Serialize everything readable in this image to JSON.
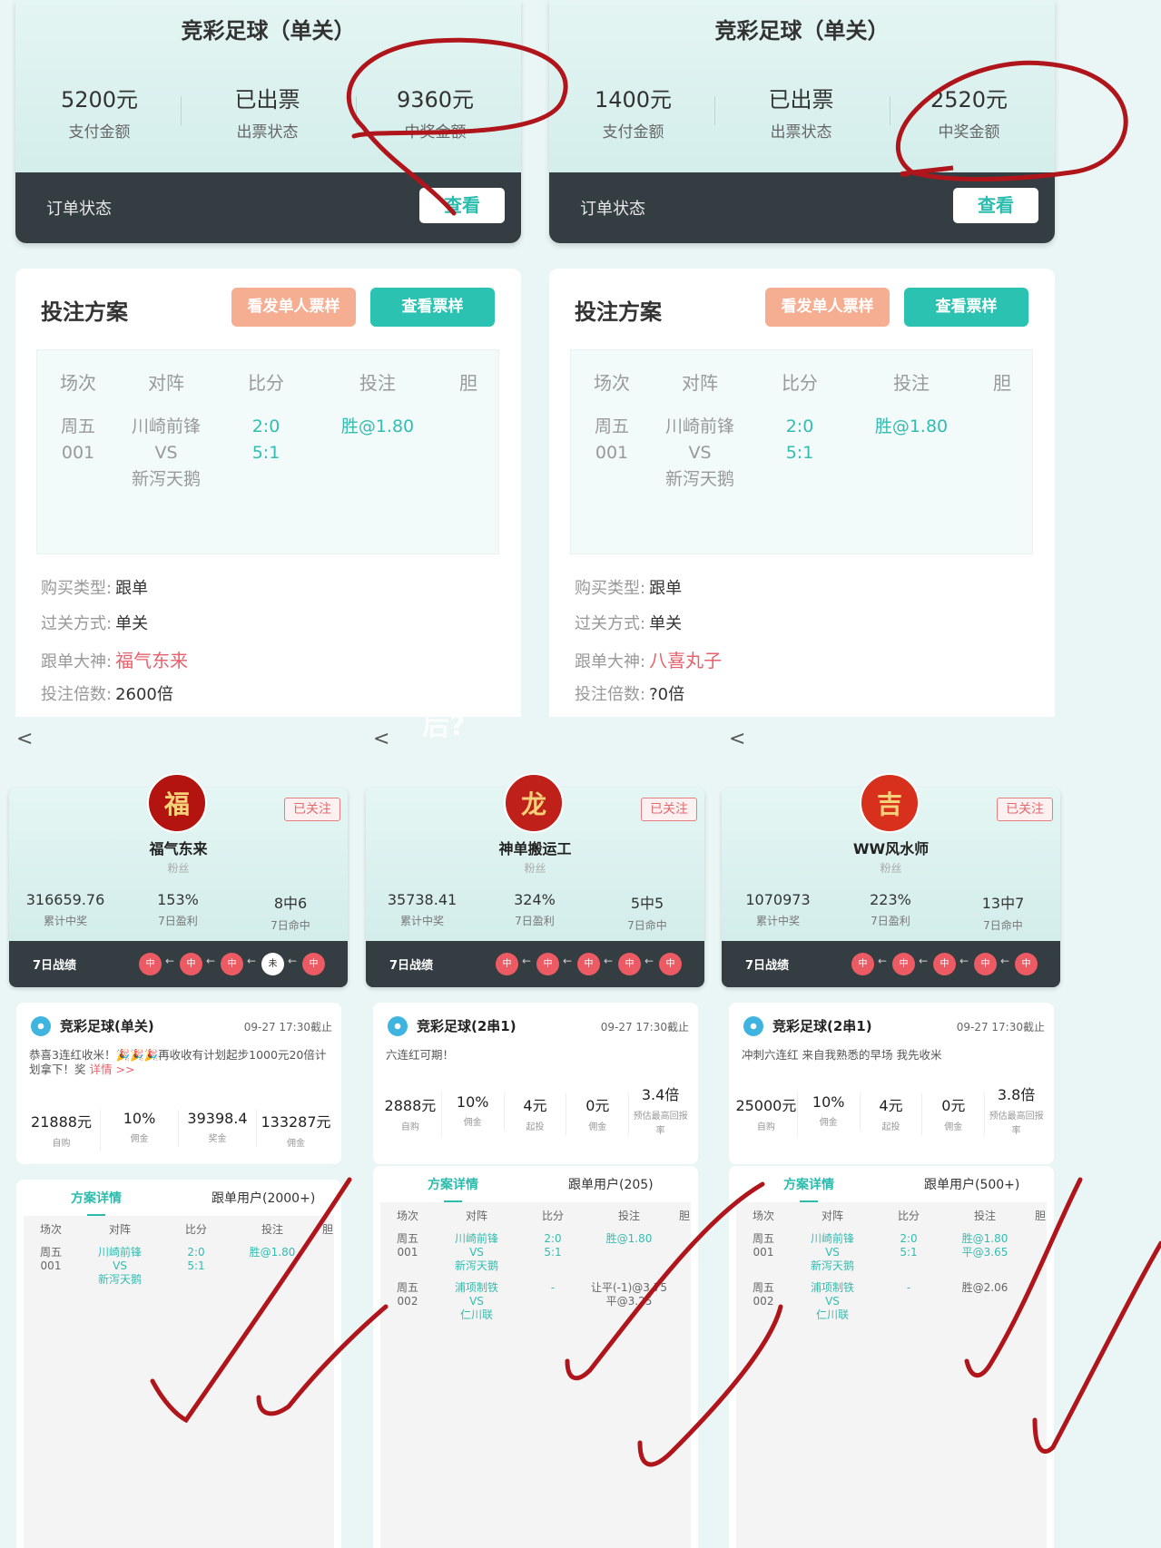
{
  "orders": [
    {
      "title": "竞彩足球（单关）",
      "stats": [
        {
          "value": "5200元",
          "label": "支付金额"
        },
        {
          "value": "已出票",
          "label": "出票状态"
        },
        {
          "value": "9360元",
          "label": "中奖金额"
        }
      ],
      "status_label": "订单状态",
      "view_button": "查看",
      "plan_title": "投注方案",
      "issuer_sample_button": "看发单人票样",
      "ticket_sample_button": "查看票样",
      "table_headers": [
        "场次",
        "对阵",
        "比分",
        "投注",
        "胆"
      ],
      "row": {
        "session": [
          "周五",
          "001"
        ],
        "match": [
          "川崎前锋",
          "VS",
          "新泻天鹅"
        ],
        "score": [
          "2:0",
          "5:1"
        ],
        "bet": "胜@1.80"
      },
      "info": [
        {
          "label": "购买类型:",
          "value": "跟单"
        },
        {
          "label": "过关方式:",
          "value": "单关"
        },
        {
          "label": "跟单大神:",
          "value": "福气东来"
        },
        {
          "label": "投注倍数:",
          "value": "2600倍"
        }
      ]
    },
    {
      "title": "竞彩足球（单关）",
      "stats": [
        {
          "value": "1400元",
          "label": "支付金额"
        },
        {
          "value": "已出票",
          "label": "出票状态"
        },
        {
          "value": "2520元",
          "label": "中奖金额"
        }
      ],
      "status_label": "订单状态",
      "view_button": "查看",
      "plan_title": "投注方案",
      "issuer_sample_button": "看发单人票样",
      "ticket_sample_button": "查看票样",
      "table_headers": [
        "场次",
        "对阵",
        "比分",
        "投注",
        "胆"
      ],
      "row": {
        "session": [
          "周五",
          "001"
        ],
        "match": [
          "川崎前锋",
          "VS",
          "新泻天鹅"
        ],
        "score": [
          "2:0",
          "5:1"
        ],
        "bet": "胜@1.80"
      },
      "info": [
        {
          "label": "购买类型:",
          "value": "跟单"
        },
        {
          "label": "过关方式:",
          "value": "单关"
        },
        {
          "label": "跟单大神:",
          "value": "八喜丸子"
        },
        {
          "label": "投注倍数:",
          "value": "?0倍"
        }
      ]
    }
  ],
  "overlay_text": "后?",
  "experts": [
    {
      "back": "<",
      "follow": "已关注",
      "avatar_text": "福",
      "avatar_color": "#b3140f",
      "name": "福气东来",
      "fans": "粉丝",
      "stats": [
        {
          "value": "316659.76",
          "label": "累计中奖"
        },
        {
          "value": "153%",
          "label": "7日盈利"
        },
        {
          "value": "8中6",
          "label": "7日命中"
        }
      ],
      "record_label": "7日战绩",
      "record": [
        "中",
        "中",
        "中",
        "未",
        "中"
      ],
      "plan": {
        "title": "竞彩足球(单关)",
        "deadline": "09-27 17:30截止",
        "desc": "恭喜3连红收米！🎉🎉🎉再收收有计划起步1000元20倍计划拿下！奖",
        "more": "详情 >>",
        "metrics": [
          {
            "value": "21888元",
            "label": "自购"
          },
          {
            "value": "10%",
            "label": "佣金"
          },
          {
            "value": "39398.4",
            "label": "奖金"
          },
          {
            "value": "133287元",
            "label": "佣金"
          }
        ]
      },
      "tabs": [
        "方案详情",
        "跟单用户(2000+)"
      ],
      "headers": [
        "场次",
        "对阵",
        "比分",
        "投注",
        "胆"
      ],
      "rows": [
        {
          "session": "周五\n001",
          "match": "川崎前锋\nVS\n新泻天鹅",
          "score": "2:0\n5:1",
          "bet": "胜@1.80"
        }
      ]
    },
    {
      "back": "<",
      "follow": "已关注",
      "avatar_text": "龙",
      "avatar_color": "#c0201a",
      "name": "神单搬运工",
      "fans": "粉丝",
      "stats": [
        {
          "value": "35738.41",
          "label": "累计中奖"
        },
        {
          "value": "324%",
          "label": "7日盈利"
        },
        {
          "value": "5中5",
          "label": "7日命中"
        }
      ],
      "record_label": "7日战绩",
      "record": [
        "中",
        "中",
        "中",
        "中",
        "中"
      ],
      "plan": {
        "title": "竞彩足球(2串1)",
        "deadline": "09-27 17:30截止",
        "desc": "六连红可期！",
        "more": "",
        "metrics": [
          {
            "value": "2888元",
            "label": "自购"
          },
          {
            "value": "10%",
            "label": "佣金"
          },
          {
            "value": "4元",
            "label": "起投"
          },
          {
            "value": "0元",
            "label": "佣金"
          },
          {
            "value": "3.4倍",
            "label": "预估最高回报率"
          }
        ]
      },
      "tabs": [
        "方案详情",
        "跟单用户(205)"
      ],
      "headers": [
        "场次",
        "对阵",
        "比分",
        "投注",
        "胆"
      ],
      "rows": [
        {
          "session": "周五\n001",
          "match": "川崎前锋\nVS\n新泻天鹅",
          "score": "2:0\n5:1",
          "bet": "胜@1.80"
        },
        {
          "session": "周五\n002",
          "match": "浦项制铁\nVS\n仁川联",
          "score": "-",
          "bet": "让平(-1)@3.75\n平@3.25"
        }
      ]
    },
    {
      "back": "<",
      "follow": "已关注",
      "avatar_text": "吉",
      "avatar_color": "#d7301c",
      "name": "WW风水师",
      "fans": "粉丝",
      "stats": [
        {
          "value": "1070973",
          "label": "累计中奖"
        },
        {
          "value": "223%",
          "label": "7日盈利"
        },
        {
          "value": "13中7",
          "label": "7日命中"
        }
      ],
      "record_label": "7日战绩",
      "record": [
        "中",
        "中",
        "中",
        "中",
        "中"
      ],
      "plan": {
        "title": "竞彩足球(2串1)",
        "deadline": "09-27 17:30截止",
        "desc": "冲刺六连红 来自我熟悉的早场 我先收米",
        "more": "",
        "metrics": [
          {
            "value": "25000元",
            "label": "自购"
          },
          {
            "value": "10%",
            "label": "佣金"
          },
          {
            "value": "4元",
            "label": "起投"
          },
          {
            "value": "0元",
            "label": "佣金"
          },
          {
            "value": "3.8倍",
            "label": "预估最高回报率"
          }
        ]
      },
      "tabs": [
        "方案详情",
        "跟单用户(500+)"
      ],
      "headers": [
        "场次",
        "对阵",
        "比分",
        "投注",
        "胆"
      ],
      "rows": [
        {
          "session": "周五\n001",
          "match": "川崎前锋\nVS\n新泻天鹅",
          "score": "2:0\n5:1",
          "bet": "胜@1.80\n平@3.65"
        },
        {
          "session": "周五\n002",
          "match": "浦项制铁\nVS\n仁川联",
          "score": "-",
          "bet": "胜@2.06"
        }
      ]
    }
  ],
  "colors": {
    "teal": "#2cbcae",
    "dark": "#343d42",
    "red": "#ec5b63",
    "annotation": "#b0151c",
    "orange": "#f6ae92"
  }
}
